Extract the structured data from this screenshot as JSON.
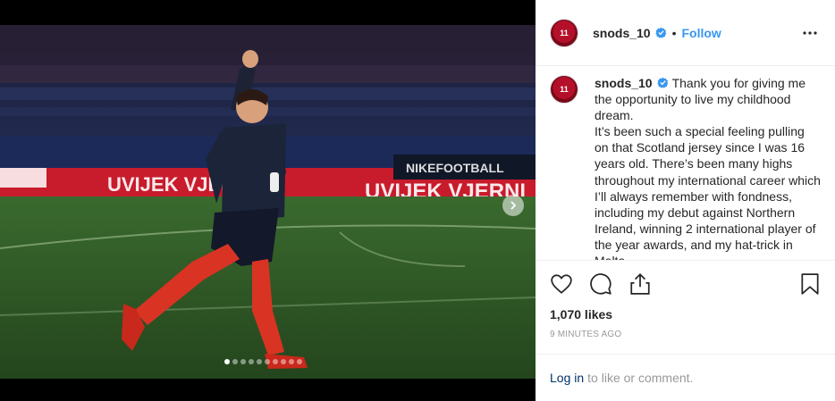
{
  "post": {
    "username": "snods_10",
    "follow_label": "Follow",
    "separator": "•",
    "avatar_text": "11",
    "caption": "Thank you for giving me the opportunity to live my childhood dream.\nIt’s been such a special feeling pulling on that Scotland jersey since I was 16 years old. There’s been many highs throughout my international career which I’ll always remember with fondness, including my debut against Northern Ireland, winning 2 international player of the year awards, and my hat-trick in Malta.",
    "likes": "1,070 likes",
    "timestamp": "9 MINUTES AGO",
    "login_label": "Log in",
    "login_suffix": "to like or comment."
  },
  "media": {
    "banner_text_1": "UVIJEK VJERNI",
    "banner_text_2": "UVIJEK VJERNI",
    "sponsor_text": "NIKEFOOTBALL",
    "carousel": {
      "count": 10,
      "active_index": 0
    }
  },
  "icons": {
    "verified": "verified-badge-icon",
    "more": "more-options-icon",
    "like": "heart-icon",
    "comment": "comment-icon",
    "share": "share-icon",
    "save": "bookmark-icon",
    "next": "chevron-right-icon"
  },
  "colors": {
    "accent": "#3897f0",
    "link": "#003569",
    "muted": "#999999",
    "verified": "#3897f0"
  }
}
